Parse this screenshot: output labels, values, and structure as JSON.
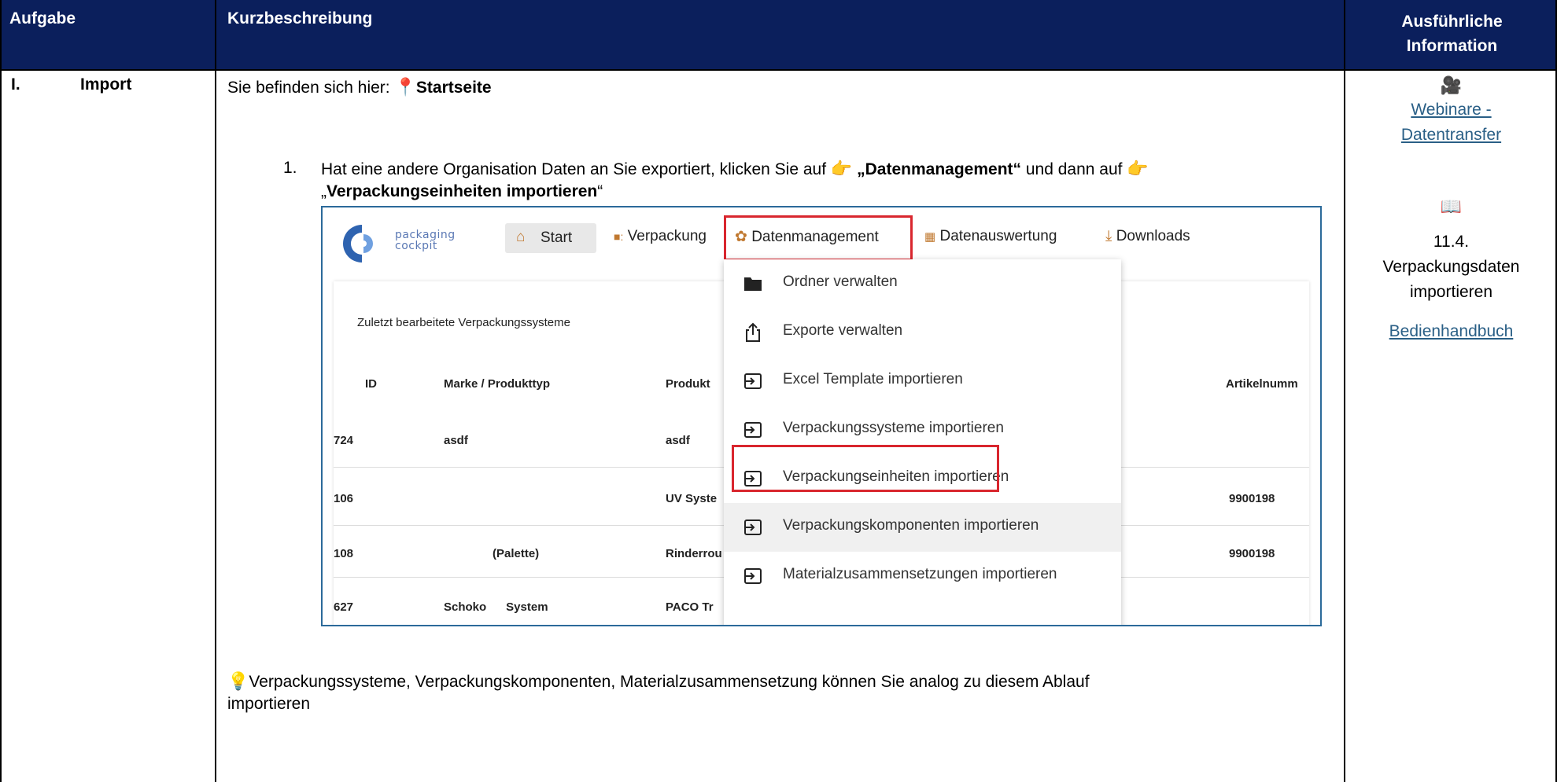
{
  "header": {
    "col1": "Aufgabe",
    "col2": "Kurzbeschreibung",
    "col3_line1": "Ausführliche",
    "col3_line2": "Information"
  },
  "row": {
    "number": "I.",
    "task": "Import",
    "location_prefix": "Sie befinden sich hier:",
    "location_icon": "pin-icon",
    "location": "Startseite",
    "step_number": "1.",
    "step_text_a": "Hat eine andere Organisation Daten an Sie exportiert, klicken Sie auf",
    "step_link1": "„Datenmanagement“",
    "step_text_b": "und dann auf",
    "step_link2_open": "„",
    "step_link2": "Verpackungseinheiten importieren",
    "step_link2_close": "“",
    "tip_icon": "lightbulb-icon",
    "tip_line1": "Verpackungssysteme, Verpackungskomponenten, Materialzusammensetzung können Sie analog zu diesem Ablauf",
    "tip_line2": "importieren"
  },
  "info": {
    "webinar_icon": "movie-camera-icon",
    "webinar_line1": "Webinare -",
    "webinar_line2": "Datentransfer",
    "manual_icon": "book-icon",
    "section_num": "11.4.",
    "section_line1": "Verpackungsdaten",
    "section_line2": "importieren",
    "manual_link": "Bedienhandbuch"
  },
  "screenshot": {
    "logo_line1": "packaging",
    "logo_line2": "cockpit",
    "nav": {
      "start": "Start",
      "packaging": "Verpackung",
      "data_mgmt": "Datenmanagement",
      "analysis": "Datenauswertung",
      "downloads": "Downloads"
    },
    "panel_title": "Zuletzt bearbeitete Verpackungssysteme",
    "columns": [
      "ID",
      "Marke / Produkttyp",
      "Produkt",
      "Artikelnumm"
    ],
    "rows": [
      {
        "id": "724",
        "brand": "asdf",
        "product": "asdf",
        "article": ""
      },
      {
        "id": "106",
        "brand": "",
        "product": "UV Syste",
        "article": "9900198"
      },
      {
        "id": "108",
        "brand": "(Palette)",
        "product": "Rinderrou",
        "article": "9900198"
      },
      {
        "id": "627",
        "brand": "Schoko      System",
        "product": "PACO Tr",
        "article": ""
      }
    ],
    "menu": [
      {
        "label": "Ordner verwalten",
        "icon": "folder-icon"
      },
      {
        "label": "Exporte verwalten",
        "icon": "share-icon"
      },
      {
        "label": "Excel Template importieren",
        "icon": "import-icon"
      },
      {
        "label": "Verpackungssysteme importieren",
        "icon": "import-icon"
      },
      {
        "label": "Verpackungseinheiten importieren",
        "icon": "import-icon"
      },
      {
        "label": "Verpackungskomponenten importieren",
        "icon": "import-icon"
      },
      {
        "label": "Materialzusammensetzungen importieren",
        "icon": "import-icon"
      }
    ]
  },
  "colors": {
    "header_bg": "#0b1f5c",
    "link": "#2a5f86",
    "highlight": "#d9262e"
  }
}
